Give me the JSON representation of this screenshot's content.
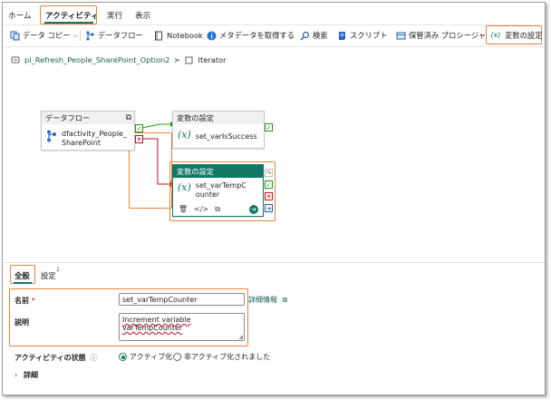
{
  "top_tabs": [
    {
      "label": "ホーム"
    },
    {
      "label": "アクティビティ"
    },
    {
      "label": "実行"
    },
    {
      "label": "表示"
    }
  ],
  "toolbar": {
    "copy_data": "データ コピー",
    "dataflow": "データフロー",
    "notebook": "Notebook",
    "get_metadata": "メタデータを取得する",
    "search": "検索",
    "script": "スクリプト",
    "stored_procedure": "保管済み プロシージャ",
    "set_variable": "変数の設定"
  },
  "breadcrumb": {
    "pipeline": "pl_Refresh_People_SharePoint_Option2",
    "separator": ">",
    "current": "Iterator"
  },
  "canvas": {
    "dataflow_node": {
      "header": "データフロー",
      "name": "dfactivity_People_SharePoint"
    },
    "set_var_success": {
      "header": "変数の設定",
      "name": "set_varIsSuccess"
    },
    "set_var_temp": {
      "header": "変数の設定",
      "name": "set_varTempCounter"
    }
  },
  "bottom": {
    "tabs": {
      "general": "全般",
      "settings": "設定",
      "settings_badge": "1"
    },
    "name_label": "名前",
    "required_mark": "*",
    "name_value": "set_varTempCounter",
    "details_link": "詳細情報",
    "description_label": "説明",
    "description_value": "Increment variable varTempCounter",
    "activity_state_label": "アクティビティの状態",
    "active_option": "アクティブ化",
    "inactive_option": "非アクティブ化されました",
    "advanced": "詳細"
  },
  "colors": {
    "accent": "#117865",
    "highlight": "#e8823a",
    "success": "#13a10e",
    "failure": "#c50f1f"
  }
}
